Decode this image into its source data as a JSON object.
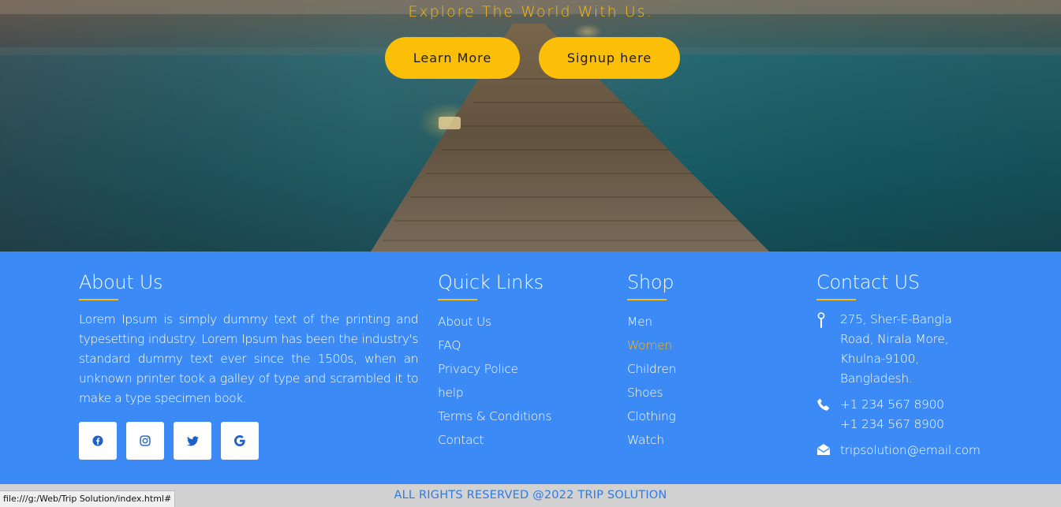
{
  "hero": {
    "tagline": "Explore The World With Us.",
    "learn_more": "Learn More",
    "signup": "Signup here"
  },
  "about": {
    "title": "About Us",
    "text": "Lorem Ipsum is simply dummy text of the printing and typesetting industry. Lorem Ipsum has been the industry's standard dummy text ever since the 1500s, when an unknown printer took a galley of type and scrambled it to make a type specimen book.",
    "social": [
      "facebook-icon",
      "instagram-icon",
      "twitter-icon",
      "google-icon"
    ]
  },
  "quick_links": {
    "title": "Quick Links",
    "items": [
      "About Us",
      "FAQ",
      "Privacy Police",
      "help",
      "Terms & Conditions",
      "Contact"
    ]
  },
  "shop": {
    "title": "Shop",
    "items": [
      "Men",
      "Women",
      "Children",
      "Shoes",
      "Clothing",
      "Watch"
    ],
    "active_item": "Women"
  },
  "contact": {
    "title": "Contact US",
    "address_lines": [
      "275, Sher-E-Bangla",
      "Road, Nirala More,",
      "Khulna-9100,",
      "Bangladesh."
    ],
    "phones": [
      "+1 234 567 8900",
      "+1 234 567 8900"
    ],
    "email": "tripsolution@email.com"
  },
  "footer": {
    "copyright": "ALL RIGHTS RESERVED @2022 TRIP SOLUTION"
  },
  "status_bar": {
    "url": "file:///g:/Web/Trip Solution/index.html#"
  },
  "colors": {
    "accent": "#fcbf07",
    "footer_bg": "#3b8af5",
    "copyright_text": "#2f7be3"
  }
}
